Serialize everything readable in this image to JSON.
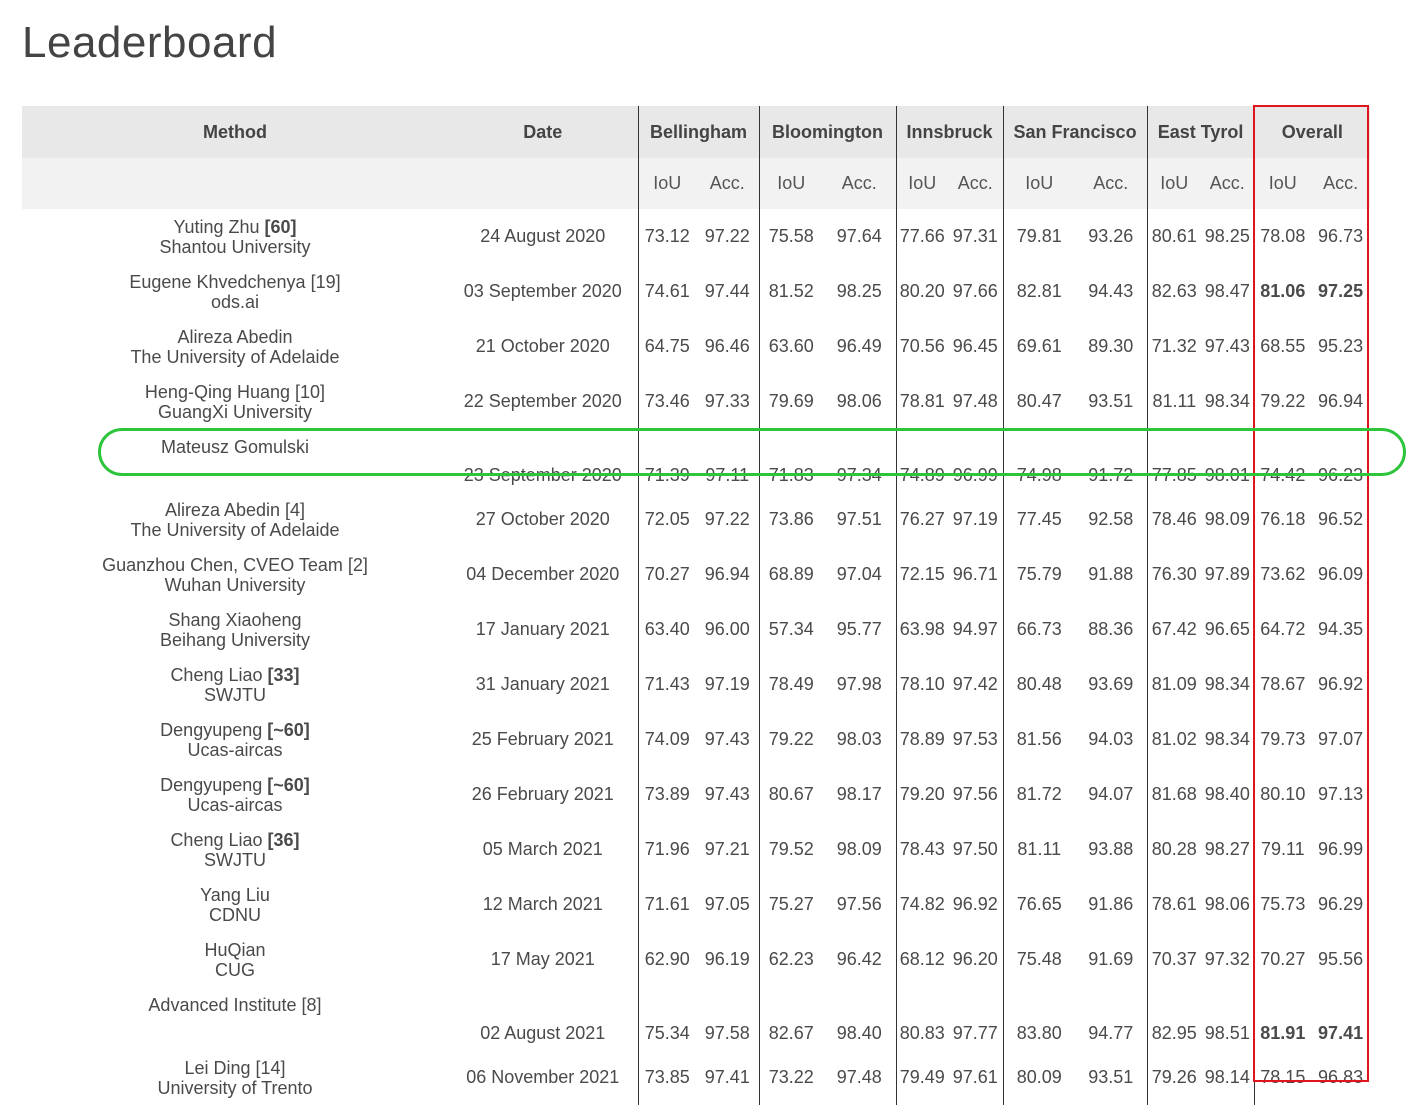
{
  "page": {
    "title": "Leaderboard"
  },
  "table": {
    "headers": {
      "method": "Method",
      "date": "Date",
      "cities": [
        "Bellingham",
        "Bloomington",
        "Innsbruck",
        "San Francisco",
        "East Tyrol",
        "Overall"
      ],
      "iou": "IoU",
      "acc": "Acc."
    },
    "rows": [
      {
        "name": "Yuting Zhu",
        "ref": "[60]",
        "ref_bold": true,
        "org": "Shantou University",
        "date": "24 August 2020",
        "scores": [
          "73.12",
          "97.22",
          "75.58",
          "97.64",
          "77.66",
          "97.31",
          "79.81",
          "93.26",
          "80.61",
          "98.25",
          "78.08",
          "96.73"
        ],
        "overall_bold": false
      },
      {
        "name": "Eugene Khvedchenya",
        "ref": "[19]",
        "ref_bold": false,
        "org": "ods.ai",
        "date": "03 September 2020",
        "scores": [
          "74.61",
          "97.44",
          "81.52",
          "98.25",
          "80.20",
          "97.66",
          "82.81",
          "94.43",
          "82.63",
          "98.47",
          "81.06",
          "97.25"
        ],
        "overall_bold": true
      },
      {
        "name": "Alireza Abedin",
        "ref": "",
        "ref_bold": false,
        "org": "The University of Adelaide",
        "date": "21 October 2020",
        "scores": [
          "64.75",
          "96.46",
          "63.60",
          "96.49",
          "70.56",
          "96.45",
          "69.61",
          "89.30",
          "71.32",
          "97.43",
          "68.55",
          "95.23"
        ],
        "overall_bold": false
      },
      {
        "name": "Heng-Qing Huang",
        "ref": "[10]",
        "ref_bold": false,
        "org": "GuangXi University",
        "date": "22 September 2020",
        "scores": [
          "73.46",
          "97.33",
          "79.69",
          "98.06",
          "78.81",
          "97.48",
          "80.47",
          "93.51",
          "81.11",
          "98.34",
          "79.22",
          "96.94"
        ],
        "overall_bold": false
      },
      {
        "name": "Mateusz Gomulski",
        "ref": "",
        "ref_bold": false,
        "org": "",
        "date": "23 September 2020",
        "scores": [
          "71.39",
          "97.11",
          "71.83",
          "97.34",
          "74.89",
          "96.99",
          "74.98",
          "91.72",
          "77.85",
          "98.01",
          "74.42",
          "96.23"
        ],
        "overall_bold": false
      },
      {
        "name": "Alireza Abedin",
        "ref": "[4]",
        "ref_bold": false,
        "org": "The University of Adelaide",
        "date": "27 October 2020",
        "scores": [
          "72.05",
          "97.22",
          "73.86",
          "97.51",
          "76.27",
          "97.19",
          "77.45",
          "92.58",
          "78.46",
          "98.09",
          "76.18",
          "96.52"
        ],
        "overall_bold": false
      },
      {
        "name": "Guanzhou Chen, CVEO Team",
        "ref": "[2]",
        "ref_bold": false,
        "org": "Wuhan University",
        "date": "04 December 2020",
        "scores": [
          "70.27",
          "96.94",
          "68.89",
          "97.04",
          "72.15",
          "96.71",
          "75.79",
          "91.88",
          "76.30",
          "97.89",
          "73.62",
          "96.09"
        ],
        "overall_bold": false
      },
      {
        "name": "Shang Xiaoheng",
        "ref": "",
        "ref_bold": false,
        "org": "Beihang University",
        "date": "17 January 2021",
        "scores": [
          "63.40",
          "96.00",
          "57.34",
          "95.77",
          "63.98",
          "94.97",
          "66.73",
          "88.36",
          "67.42",
          "96.65",
          "64.72",
          "94.35"
        ],
        "overall_bold": false
      },
      {
        "name": "Cheng Liao",
        "ref": "[33]",
        "ref_bold": true,
        "org": "SWJTU",
        "date": "31 January 2021",
        "scores": [
          "71.43",
          "97.19",
          "78.49",
          "97.98",
          "78.10",
          "97.42",
          "80.48",
          "93.69",
          "81.09",
          "98.34",
          "78.67",
          "96.92"
        ],
        "overall_bold": false
      },
      {
        "name": "Dengyupeng",
        "ref": "[~60]",
        "ref_bold": true,
        "org": "Ucas-aircas",
        "date": "25 February 2021",
        "scores": [
          "74.09",
          "97.43",
          "79.22",
          "98.03",
          "78.89",
          "97.53",
          "81.56",
          "94.03",
          "81.02",
          "98.34",
          "79.73",
          "97.07"
        ],
        "overall_bold": false
      },
      {
        "name": "Dengyupeng",
        "ref": "[~60]",
        "ref_bold": true,
        "org": "Ucas-aircas",
        "date": "26 February 2021",
        "scores": [
          "73.89",
          "97.43",
          "80.67",
          "98.17",
          "79.20",
          "97.56",
          "81.72",
          "94.07",
          "81.68",
          "98.40",
          "80.10",
          "97.13"
        ],
        "overall_bold": false
      },
      {
        "name": "Cheng Liao",
        "ref": "[36]",
        "ref_bold": true,
        "org": "SWJTU",
        "date": "05 March 2021",
        "scores": [
          "71.96",
          "97.21",
          "79.52",
          "98.09",
          "78.43",
          "97.50",
          "81.11",
          "93.88",
          "80.28",
          "98.27",
          "79.11",
          "96.99"
        ],
        "overall_bold": false
      },
      {
        "name": "Yang Liu",
        "ref": "",
        "ref_bold": false,
        "org": "CDNU",
        "date": "12 March 2021",
        "scores": [
          "71.61",
          "97.05",
          "75.27",
          "97.56",
          "74.82",
          "96.92",
          "76.65",
          "91.86",
          "78.61",
          "98.06",
          "75.73",
          "96.29"
        ],
        "overall_bold": false
      },
      {
        "name": "HuQian",
        "ref": "",
        "ref_bold": false,
        "org": "CUG",
        "date": "17 May 2021",
        "scores": [
          "62.90",
          "96.19",
          "62.23",
          "96.42",
          "68.12",
          "96.20",
          "75.48",
          "91.69",
          "70.37",
          "97.32",
          "70.27",
          "95.56"
        ],
        "overall_bold": false
      },
      {
        "name": "Advanced Institute",
        "ref": "[8]",
        "ref_bold": false,
        "org": "",
        "date": "02 August 2021",
        "scores": [
          "75.34",
          "97.58",
          "82.67",
          "98.40",
          "80.83",
          "97.77",
          "83.80",
          "94.77",
          "82.95",
          "98.51",
          "81.91",
          "97.41"
        ],
        "overall_bold": true
      },
      {
        "name": "Lei Ding",
        "ref": "[14]",
        "ref_bold": false,
        "org": "University of Trento",
        "date": "06 November 2021",
        "scores": [
          "73.85",
          "97.41",
          "73.22",
          "97.48",
          "79.49",
          "97.61",
          "80.09",
          "93.51",
          "79.26",
          "98.14",
          "78.15",
          "96.83"
        ],
        "overall_bold": false
      }
    ]
  },
  "highlights": {
    "overall_box_color": "#e0141e",
    "row_outline_color": "#2ec43c",
    "row_outline_index": 4
  }
}
